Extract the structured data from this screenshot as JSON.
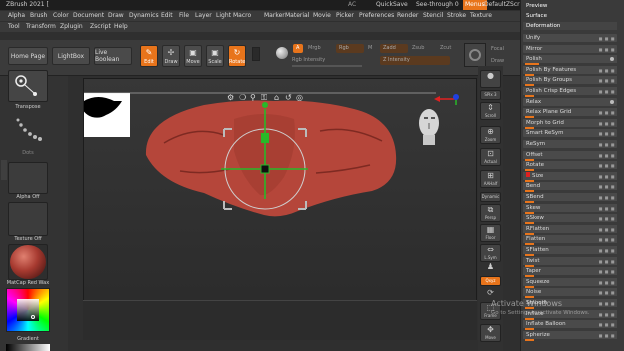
{
  "titlebar": {
    "title": "ZBrush 2021 [",
    "ac": "AC",
    "quicksave": "QuickSave",
    "seethrough": "See-through  0",
    "menus": "Menus",
    "script": "DefaultZScript"
  },
  "menu_row1": [
    "Alpha",
    "Brush",
    "Color",
    "Document",
    "Draw",
    "Dynamics",
    "Edit",
    "File",
    "Layer",
    "Light",
    "Macro",
    "Marker",
    "Material",
    "Movie",
    "Picker",
    "Preferences",
    "Render",
    "Stencil",
    "Stroke",
    "Texture"
  ],
  "menu_row2": [
    "Tool",
    "Transform",
    "Zplugin",
    "Zscript",
    "Help"
  ],
  "shelf": {
    "home": "Home Page",
    "lightbox": "LightBox",
    "liveboolean": "Live Boolean",
    "edit": "Edit",
    "draw": "Draw",
    "move": "Move",
    "scale": "Scale",
    "rotate": "Rotate",
    "a_label": "A",
    "mrgb": "Mrgb",
    "rgb": "Rgb",
    "m": "M",
    "zadd": "Zadd",
    "zsub": "Zsub",
    "zcut": "Zcut",
    "rgb_intensity": "Rgb Intensity",
    "z_intensity": "Z Intensity",
    "focal": "Focal",
    "draw_size": "Draw"
  },
  "left": {
    "transpose": "Transpose",
    "dots": "Dots",
    "alpha": "Alpha Off",
    "texture": "Texture Off",
    "material": "MatCap Red Wax",
    "gradient": "Gradient"
  },
  "dock": {
    "spix": "SPix 3",
    "scroll": "Scroll",
    "zoom": "Zoom",
    "actual": "Actual",
    "aahalf": "AAHalf",
    "dynamic": "Dynamic",
    "persp": "Persp",
    "floor": "Floor",
    "lsym": "L.Sym",
    "xyz": "Qxyz",
    "frame": "Frame",
    "move": "Move"
  },
  "panel": {
    "preview": "Preview",
    "surface": "Surface",
    "deformation": "Deformation",
    "items": [
      {
        "label": "Unify",
        "kind": "btn"
      },
      {
        "label": "Mirror",
        "kind": "btn"
      },
      {
        "label": "Polish",
        "kind": "slider",
        "fill": 0.15,
        "dot": true
      },
      {
        "label": "Polish By Features",
        "kind": "slider",
        "fill": 0.1
      },
      {
        "label": "Polish By Groups",
        "kind": "slider",
        "fill": 0.1
      },
      {
        "label": "Polish Crisp Edges",
        "kind": "slider",
        "fill": 0.1
      },
      {
        "label": "Relax",
        "kind": "btn",
        "dot": true
      },
      {
        "label": "Relax Plane Grid",
        "kind": "slider",
        "fill": 0.1
      },
      {
        "label": "Morph to Grid",
        "kind": "slider",
        "fill": 0.1
      },
      {
        "label": "Smart ReSym",
        "kind": "btn"
      },
      {
        "label": "ReSym",
        "kind": "btn"
      },
      {
        "label": "Offset",
        "kind": "slider",
        "fill": 0.1
      },
      {
        "label": "Rotate",
        "kind": "slider",
        "fill": 0.1
      },
      {
        "label": "Size",
        "kind": "slider",
        "fill": 0.1,
        "marker": "0"
      },
      {
        "label": "Bend",
        "kind": "slider",
        "fill": 0.1
      },
      {
        "label": "SBend",
        "kind": "slider",
        "fill": 0.1
      },
      {
        "label": "Skew",
        "kind": "slider",
        "fill": 0.1
      },
      {
        "label": "SSkew",
        "kind": "slider",
        "fill": 0.1
      },
      {
        "label": "RFlatten",
        "kind": "slider",
        "fill": 0.1
      },
      {
        "label": "Flatten",
        "kind": "slider",
        "fill": 0.1
      },
      {
        "label": "SFlatten",
        "kind": "slider",
        "fill": 0.1
      },
      {
        "label": "Twist",
        "kind": "slider",
        "fill": 0.1
      },
      {
        "label": "Taper",
        "kind": "slider",
        "fill": 0.1
      },
      {
        "label": "Squeeze",
        "kind": "slider",
        "fill": 0.1
      },
      {
        "label": "Noise",
        "kind": "slider",
        "fill": 0.1
      },
      {
        "label": "Smooth",
        "kind": "slider",
        "fill": 0.1
      },
      {
        "label": "Inflate",
        "kind": "slider",
        "fill": 0.1
      },
      {
        "label": "Inflate Balloon",
        "kind": "slider",
        "fill": 0.1
      },
      {
        "label": "Spherize",
        "kind": "slider",
        "fill": 0.1
      }
    ]
  },
  "watermark": {
    "line1": "Activate Windows",
    "line2": "Go to Settings to activate Windows."
  },
  "colors": {
    "accent": "#e8741b",
    "model": "#b5463a",
    "gizmo_green": "#28b828",
    "gizmo_red": "#e02020",
    "gizmo_blue": "#2040e0"
  }
}
